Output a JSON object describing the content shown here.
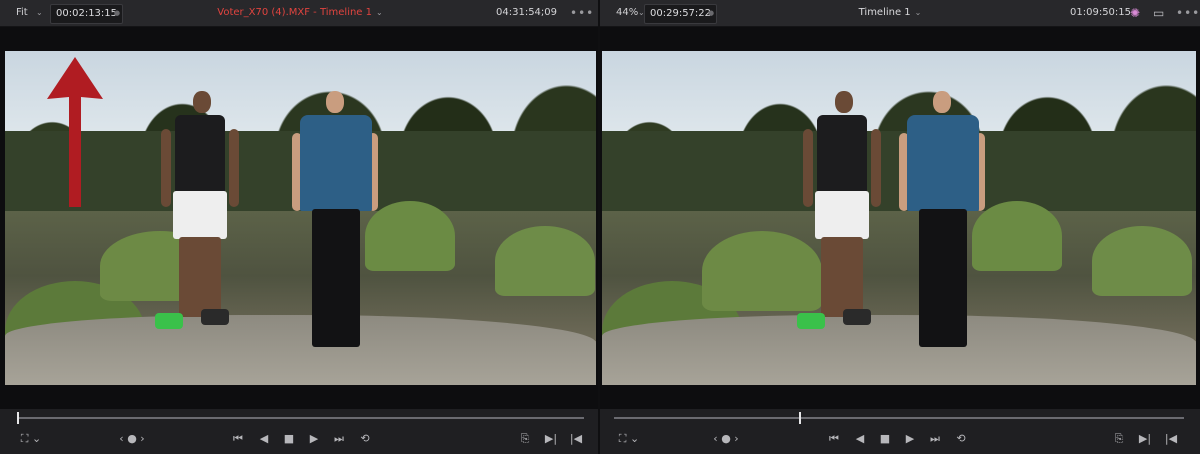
{
  "left_viewer": {
    "zoom": "Fit",
    "timecode": "00:02:13:15",
    "clip_title": "Voter_X70 (4).MXF - Timeline 1",
    "title_color": "#e0443f",
    "record_timecode": "04:31:54;09",
    "more_icon": "ellipsis-icon",
    "transport": {
      "view_icon": "frame-icon",
      "nav": "‹ ● ›",
      "buttons": [
        "skip-to-start-icon",
        "step-back-icon",
        "stop-icon",
        "play-icon",
        "skip-to-end-icon",
        "loop-icon"
      ],
      "right_buttons": [
        "match-frame-icon",
        "next-marker-icon",
        "previous-marker-icon"
      ]
    },
    "scrub_position_fraction": 0.0
  },
  "right_viewer": {
    "zoom": "44%",
    "timecode": "00:29:57:22",
    "title": "Timeline 1",
    "record_timecode": "01:09:50:15",
    "color_icon": "color-wheel-icon",
    "layout_icon": "single-viewer-icon",
    "more_icon": "ellipsis-icon",
    "transport": {
      "view_icon": "frame-icon",
      "nav": "‹ ● ›",
      "buttons": [
        "skip-to-start-icon",
        "step-back-icon",
        "stop-icon",
        "play-icon",
        "skip-to-end-icon",
        "loop-icon"
      ],
      "right_buttons": [
        "match-frame-icon",
        "next-marker-icon",
        "previous-marker-icon"
      ]
    },
    "scrub_position_fraction": 0.31
  },
  "annotation": {
    "arrow_color": "#b01c22",
    "arrow_icon": "up-arrow-annotation"
  },
  "glyphs": {
    "chevron": "⌄",
    "ellipsis": "•••",
    "dot": "●",
    "view": "⛶ ⌄",
    "skip_start": "⏮",
    "step_back": "◀",
    "stop": "■",
    "play": "▶",
    "skip_end": "⏭",
    "loop": "⟲",
    "match": "⎘",
    "next_marker": "▶|",
    "prev_marker": "|◀",
    "color_wheel": "✺",
    "layout": "▭"
  }
}
